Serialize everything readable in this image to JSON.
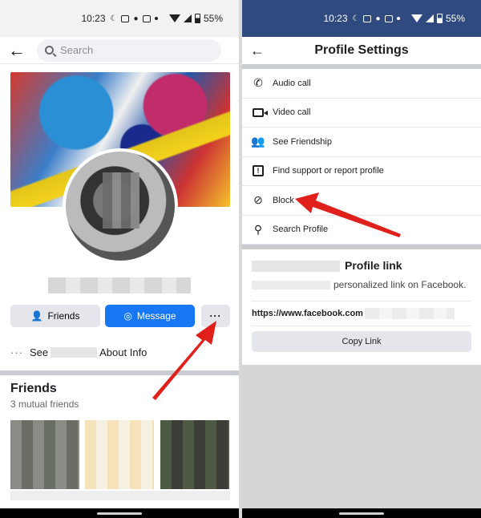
{
  "left": {
    "status": {
      "time": "10:23",
      "battery": "55%"
    },
    "search": {
      "placeholder": "Search"
    },
    "buttons": {
      "friends": "Friends",
      "message": "Message",
      "more": "···"
    },
    "about": {
      "prefix": "See",
      "suffix": "About Info"
    },
    "friends_section": {
      "title": "Friends",
      "subtitle": "3 mutual friends"
    }
  },
  "right": {
    "status": {
      "time": "10:23",
      "battery": "55%"
    },
    "header": {
      "title": "Profile Settings"
    },
    "menu": [
      {
        "label": "Audio call",
        "icon": "phone-icon"
      },
      {
        "label": "Video call",
        "icon": "video-camera-icon"
      },
      {
        "label": "See Friendship",
        "icon": "friends-icon"
      },
      {
        "label": "Find support or report profile",
        "icon": "report-icon"
      },
      {
        "label": "Block",
        "icon": "block-user-icon"
      },
      {
        "label": "Search Profile",
        "icon": "search-icon"
      }
    ],
    "profile_link": {
      "heading": "Profile link",
      "description": "personalized link on Facebook.",
      "url": "https://www.facebook.com",
      "copy_label": "Copy Link"
    }
  },
  "colors": {
    "accent": "#1877f2",
    "annotation_arrow": "#e0201b",
    "status_bar_right": "#2f4a7e"
  }
}
